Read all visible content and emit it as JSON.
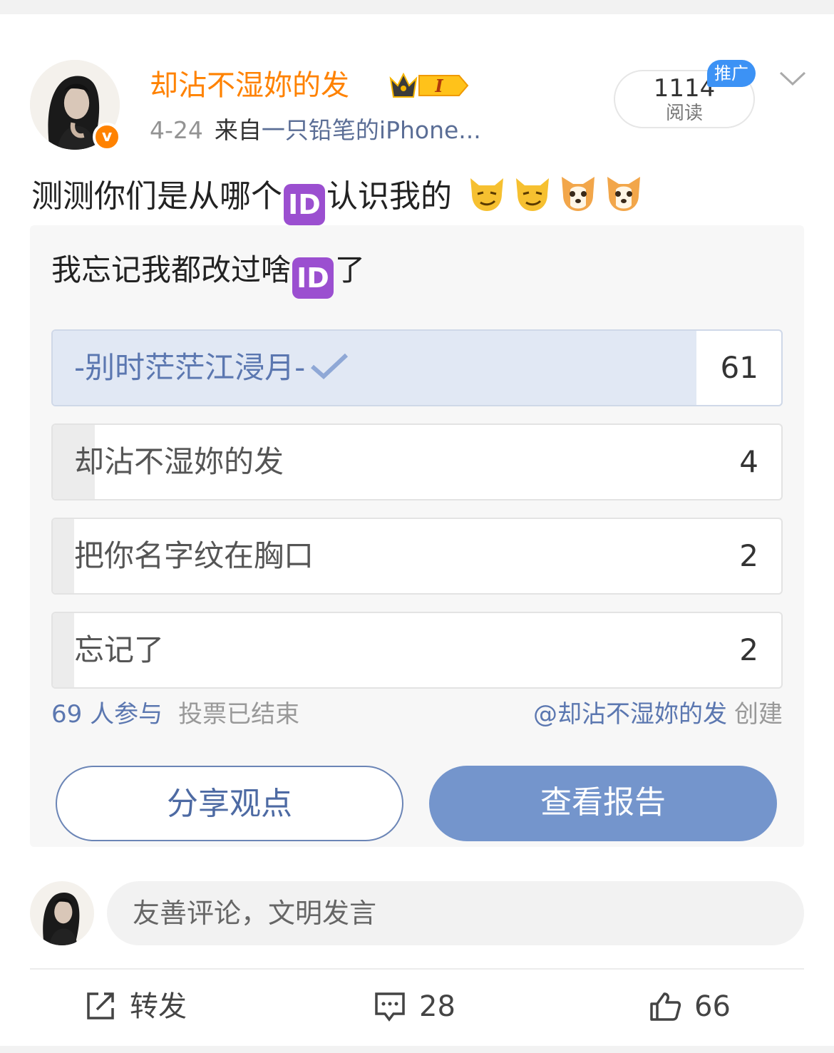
{
  "post": {
    "username": "却沾不湿妳的发",
    "vip_level": "I",
    "date": "4-24",
    "source_prefix": "来自",
    "source_device": "一只铅笔的iPhone...",
    "reads_count": "1114",
    "reads_label": "阅读",
    "promo_label": "推广",
    "text_before_id": "测测你们是从哪个",
    "text_after_id": "认识我的",
    "id_glyph": "ID",
    "emojis": [
      "cat-smirk-icon",
      "cat-smirk-icon",
      "dog-face-icon",
      "dog-face-icon"
    ]
  },
  "poll": {
    "title_before": "我忘记我都改过啥",
    "title_after": "了",
    "options": [
      {
        "label": "-别时茫茫江浸月-",
        "count": "61",
        "share": 0.884,
        "selected": true
      },
      {
        "label": "却沾不湿妳的发",
        "count": "4",
        "share": 0.058,
        "selected": false
      },
      {
        "label": "把你名字纹在胸口",
        "count": "2",
        "share": 0.029,
        "selected": false
      },
      {
        "label": "忘记了",
        "count": "2",
        "share": 0.029,
        "selected": false
      }
    ],
    "participants": "69 人参与",
    "status": "投票已结束",
    "creator": "@却沾不湿妳的发",
    "creator_action": "创建",
    "share_button": "分享观点",
    "report_button": "查看报告"
  },
  "comment_box": {
    "placeholder": "友善评论，文明发言"
  },
  "actions": {
    "repost_label": "转发",
    "comment_count": "28",
    "like_count": "66"
  },
  "colors": {
    "username": "#ff8200",
    "link": "#5b77b0",
    "report_button": "#7495cc",
    "selected_fill": "#e1e8f4",
    "promo_badge": "#3c92f5"
  }
}
